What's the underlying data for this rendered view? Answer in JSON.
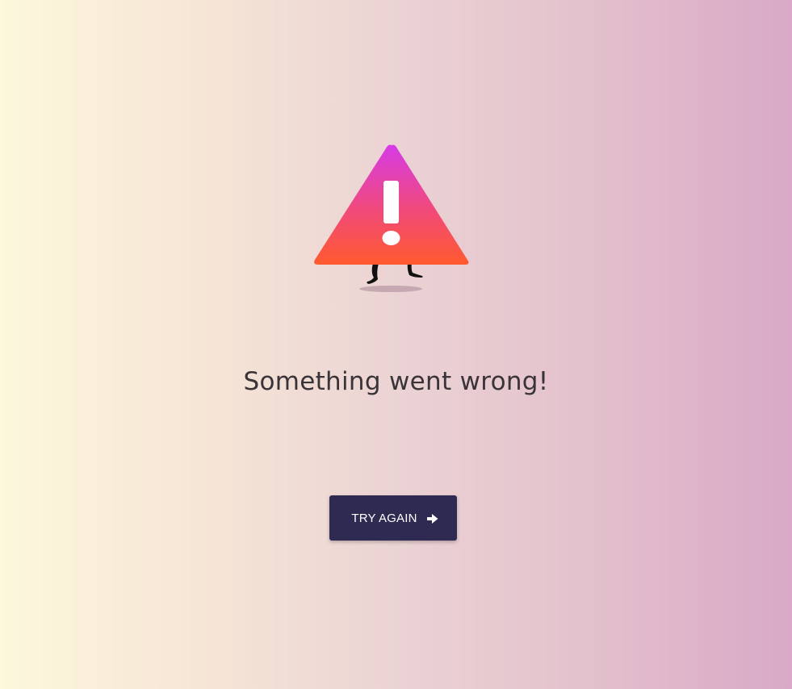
{
  "error": {
    "illustration_icon": "walking-warning-triangle-icon",
    "headline": "Something went wrong!"
  },
  "retry": {
    "label": "TRY AGAIN",
    "icon": "arrow-right-icon"
  },
  "colors": {
    "background_left": "#fdf7dc",
    "background_right": "#d9a9c7",
    "triangle_top": "#d63be6",
    "triangle_bottom": "#ff5a2e",
    "button_bg": "#2f2a52",
    "text": "#3a3338"
  }
}
